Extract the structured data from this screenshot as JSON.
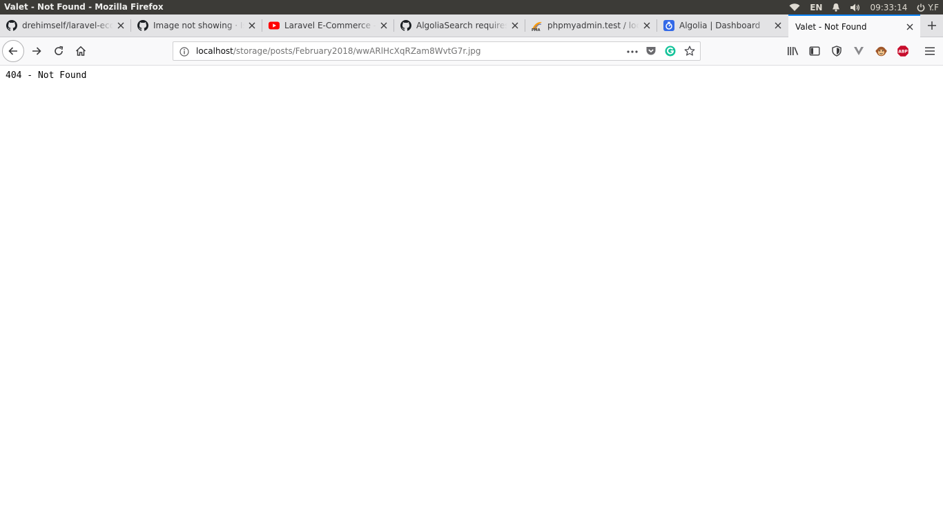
{
  "os_bar": {
    "window_title": "Valet - Not Found - Mozilla Firefox",
    "language": "EN",
    "clock": "09:33:14",
    "user": "Y.F",
    "icons": [
      "wifi-icon",
      "bell-icon",
      "volume-icon",
      "power-icon"
    ]
  },
  "tabs": [
    {
      "title": "drehimself/laravel-ecommerce",
      "favicon": "github-icon",
      "active": false
    },
    {
      "title": "Image not showing · Issue",
      "favicon": "github-icon",
      "active": false
    },
    {
      "title": "Laravel E-Commerce - Search",
      "favicon": "youtube-icon",
      "active": false
    },
    {
      "title": "AlgoliaSearch requires an",
      "favicon": "github-icon",
      "active": false
    },
    {
      "title": "phpmyadmin.test / localhost",
      "favicon": "phpmyadmin-icon",
      "active": false
    },
    {
      "title": "Algolia | Dashboard",
      "favicon": "algolia-icon",
      "active": false
    },
    {
      "title": "Valet - Not Found",
      "favicon": "",
      "active": true
    }
  ],
  "urlbar": {
    "host": "localhost",
    "path": "/storage/posts/February2018/wwARlHcXqRZam8WvtG7r.jpg"
  },
  "toolbar_icons": [
    "library-icon",
    "sidebar-icon",
    "shield-icon",
    "vivaldi-v-icon",
    "monkey-icon",
    "adblock-icon",
    "menu-icon"
  ],
  "page": {
    "message": "404 - Not Found"
  },
  "colors": {
    "active_tab_accent": "#0a84ff",
    "youtube_red": "#ff0000",
    "adblock_red": "#c70d2c",
    "grammarly_green": "#15c39a"
  }
}
